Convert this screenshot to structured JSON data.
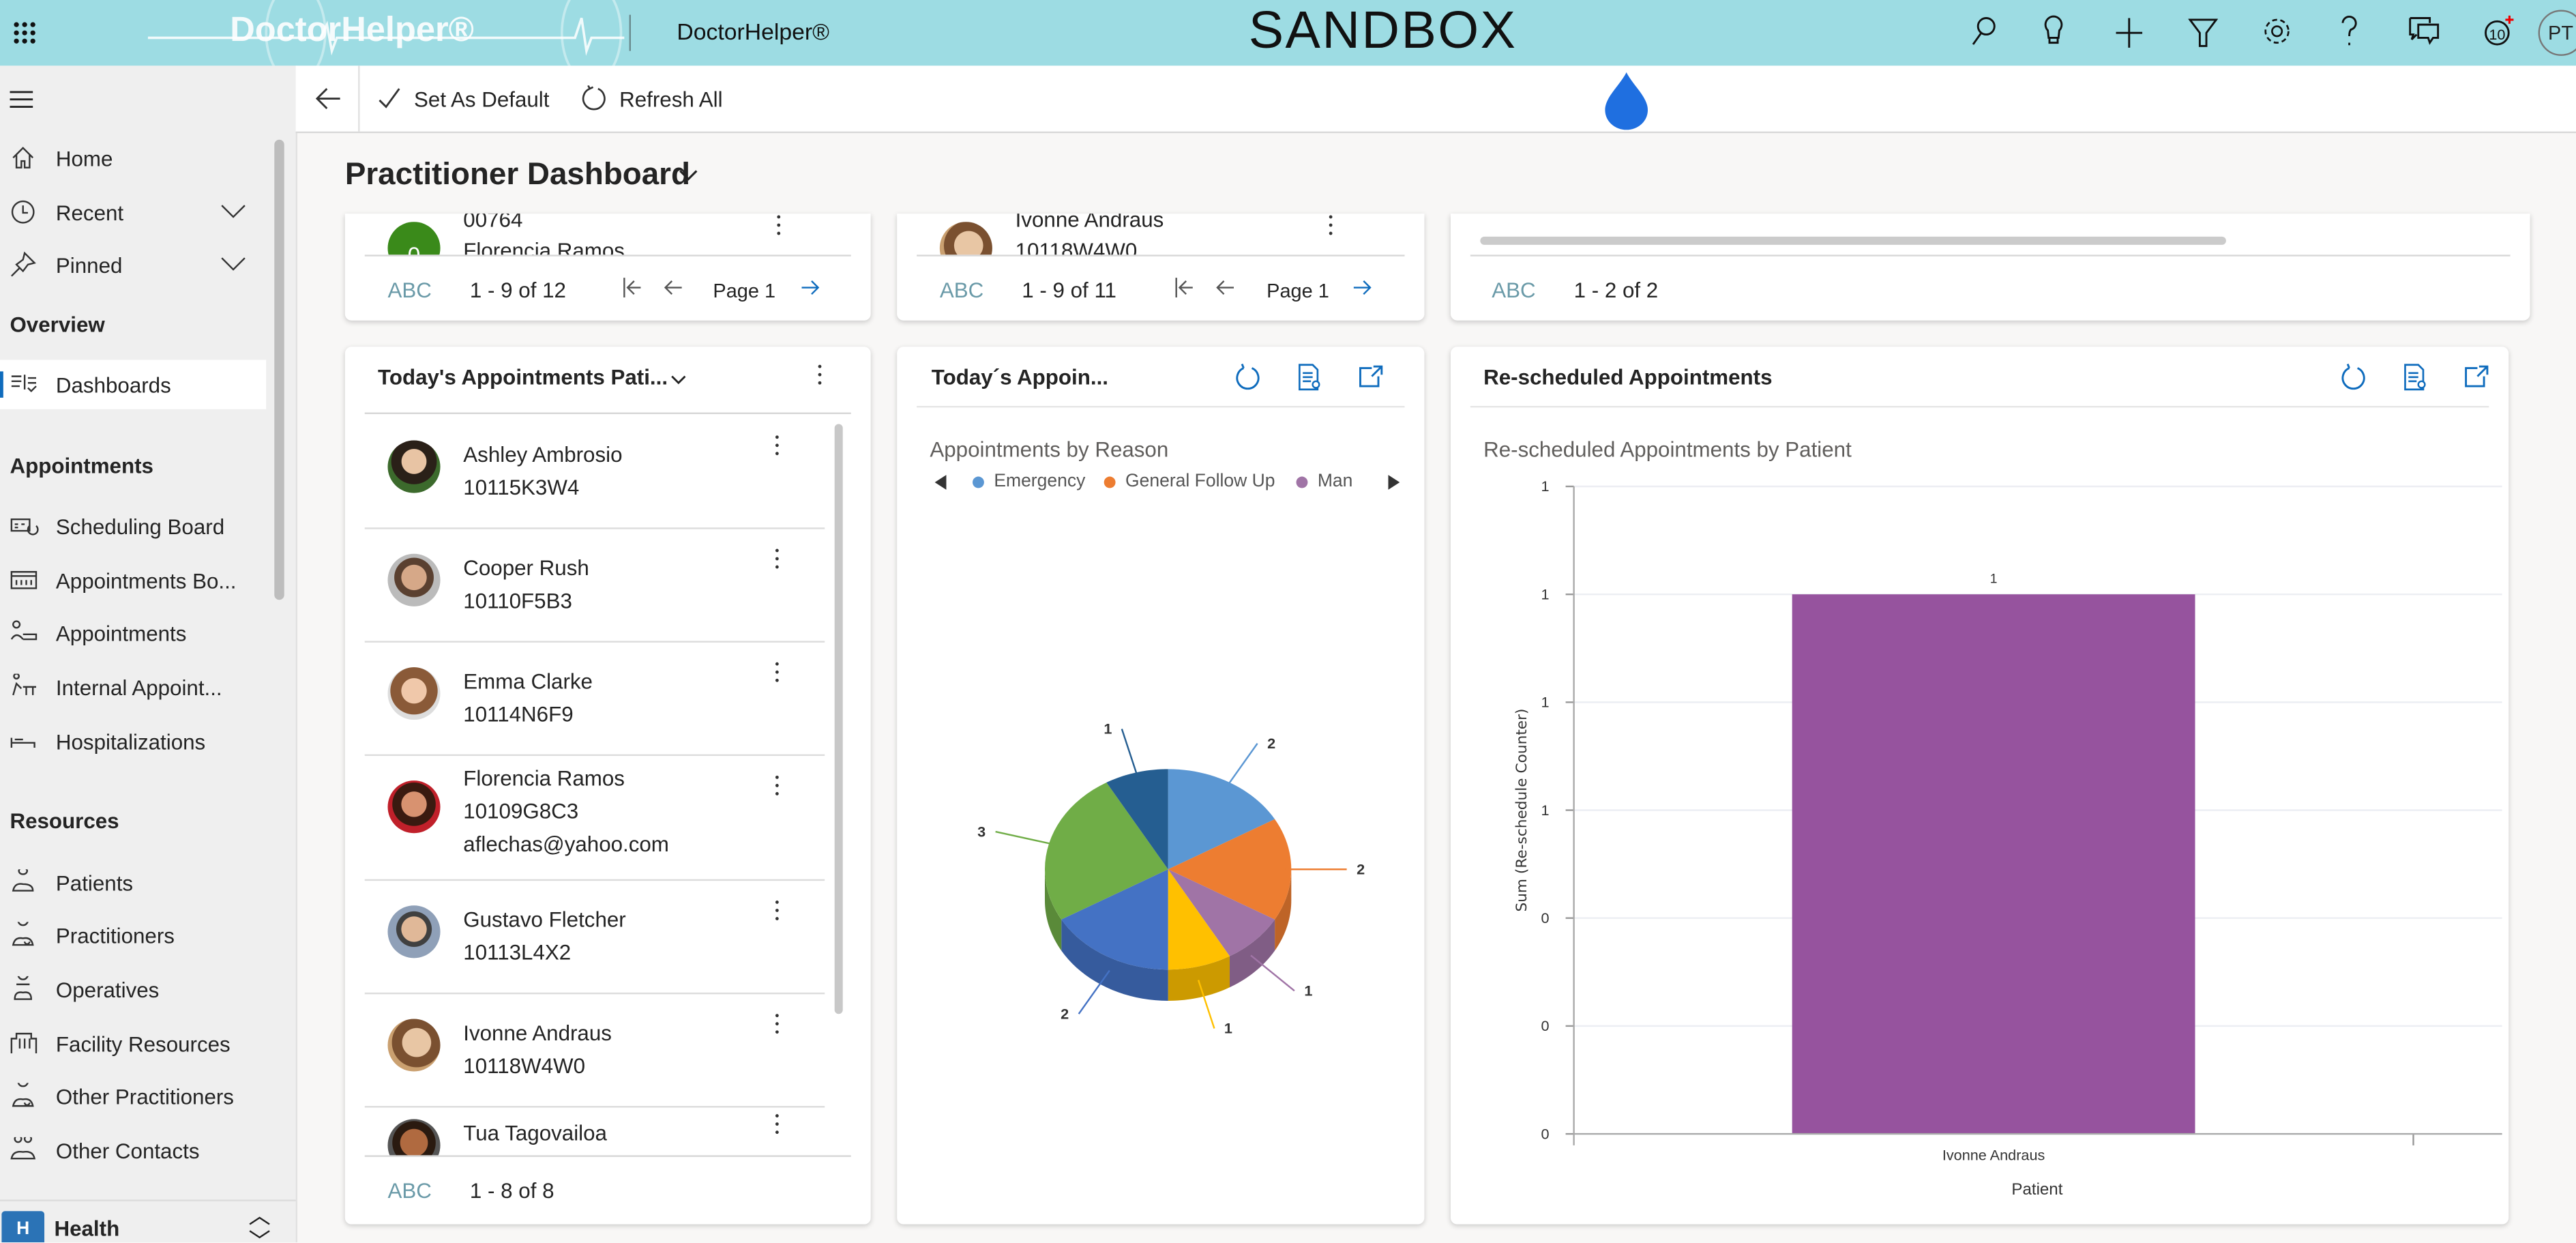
{
  "topbar": {
    "logo_text": "DoctorHelper®",
    "app_name": "DoctorHelper®",
    "environment": "SANDBOX",
    "avatar_initials": "PT",
    "background": "#9ddce3",
    "icons": [
      "search-icon",
      "lightbulb-icon",
      "plus-icon",
      "filter-icon",
      "settings-icon",
      "help-icon",
      "chat-icon",
      "notifications-icon"
    ]
  },
  "sidebar": {
    "nav": [
      {
        "label": "Home",
        "icon": "home-icon"
      },
      {
        "label": "Recent",
        "icon": "clock-icon",
        "expandable": true
      },
      {
        "label": "Pinned",
        "icon": "pin-icon",
        "expandable": true
      }
    ],
    "sections": [
      {
        "title": "Overview",
        "items": [
          {
            "label": "Dashboards",
            "icon": "dashboard-icon",
            "selected": true
          }
        ]
      },
      {
        "title": "Appointments",
        "items": [
          {
            "label": "Scheduling Board",
            "icon": "scheduling-board-icon"
          },
          {
            "label": "Appointments Bo...",
            "icon": "calendar-icon"
          },
          {
            "label": "Appointments",
            "icon": "appointment-icon"
          },
          {
            "label": "Internal Appoint...",
            "icon": "internal-appointment-icon"
          },
          {
            "label": "Hospitalizations",
            "icon": "bed-icon"
          }
        ]
      },
      {
        "title": "Resources",
        "items": [
          {
            "label": "Patients",
            "icon": "patient-icon"
          },
          {
            "label": "Practitioners",
            "icon": "practitioner-icon"
          },
          {
            "label": "Operatives",
            "icon": "operative-icon"
          },
          {
            "label": "Facility Resources",
            "icon": "building-icon"
          },
          {
            "label": "Other Practitioners",
            "icon": "practitioner-icon"
          },
          {
            "label": "Other Contacts",
            "icon": "contacts-icon"
          }
        ]
      }
    ],
    "area": {
      "badge": "H",
      "label": "Health"
    }
  },
  "commandbar": {
    "set_default": "Set As Default",
    "refresh_all": "Refresh All"
  },
  "page": {
    "title": "Practitioner Dashboard"
  },
  "top_cards": [
    {
      "row_top": "00764",
      "row_bottom": "Florencia Ramos",
      "avatar_letter": "0",
      "abc": "ABC",
      "count": "1 - 9 of 12",
      "page": "Page 1"
    },
    {
      "row_top": "Ivonne Andraus",
      "row_bottom": "10118W4W0",
      "abc": "ABC",
      "count": "1 - 9 of 11",
      "page": "Page 1"
    },
    {
      "abc": "ABC",
      "count": "1 - 2 of 2"
    }
  ],
  "patients_card": {
    "title": "Today's Appointments Pati...",
    "rows": [
      {
        "name": "Ashley Ambrosio",
        "id": "10115K3W4"
      },
      {
        "name": "Cooper Rush",
        "id": "10110F5B3"
      },
      {
        "name": "Emma Clarke",
        "id": "10114N6F9"
      },
      {
        "name": "Florencia Ramos",
        "id": "10109G8C3",
        "email": "aflechas@yahoo.com"
      },
      {
        "name": "Gustavo Fletcher",
        "id": "10113L4X2"
      },
      {
        "name": "Ivonne Andraus",
        "id": "10118W4W0"
      },
      {
        "name": "Tua Tagovailoa",
        "id": ""
      }
    ],
    "abc": "ABC",
    "count": "1 - 8 of 8"
  },
  "reason_card": {
    "title": "Today´s Appoin..."
  },
  "reschedule_card": {
    "title": "Re-scheduled Appointments"
  },
  "chart_data": [
    {
      "type": "pie",
      "title": "Appointments by Reason",
      "three_d": true,
      "legend_position": "top",
      "legend": [
        {
          "name": "Emergency",
          "color": "#5b97d3"
        },
        {
          "name": "General Follow Up",
          "color": "#ed7d31"
        },
        {
          "name": "Man",
          "color": "#a074a6"
        }
      ],
      "slices": [
        {
          "name": "Emergency",
          "value": 2,
          "color": "#5b97d3"
        },
        {
          "name": "General Follow Up",
          "value": 2,
          "color": "#ed7d31"
        },
        {
          "name": "Man",
          "value": 1,
          "color": "#a074a6"
        },
        {
          "value": 1,
          "color": "#ffc000"
        },
        {
          "value": 2,
          "color": "#4472c4"
        },
        {
          "value": 3,
          "color": "#70ad47"
        },
        {
          "value": 1,
          "color": "#255e91"
        }
      ]
    },
    {
      "type": "bar",
      "title": "Re-scheduled Appointments by Patient",
      "xlabel": "Patient",
      "ylabel": "Sum (Re-schedule Counter)",
      "categories": [
        "Ivonne Andraus"
      ],
      "values": [
        1
      ],
      "data_labels": [
        "1"
      ],
      "color": "#96539e",
      "ylim": [
        0,
        1.2
      ],
      "yticks": [
        0,
        0.2,
        0.4,
        0.6,
        0.8,
        1.0,
        1.2
      ],
      "ytick_labels": [
        "0",
        "0",
        "0",
        "1",
        "1",
        "1",
        "1"
      ],
      "grid": true
    }
  ]
}
